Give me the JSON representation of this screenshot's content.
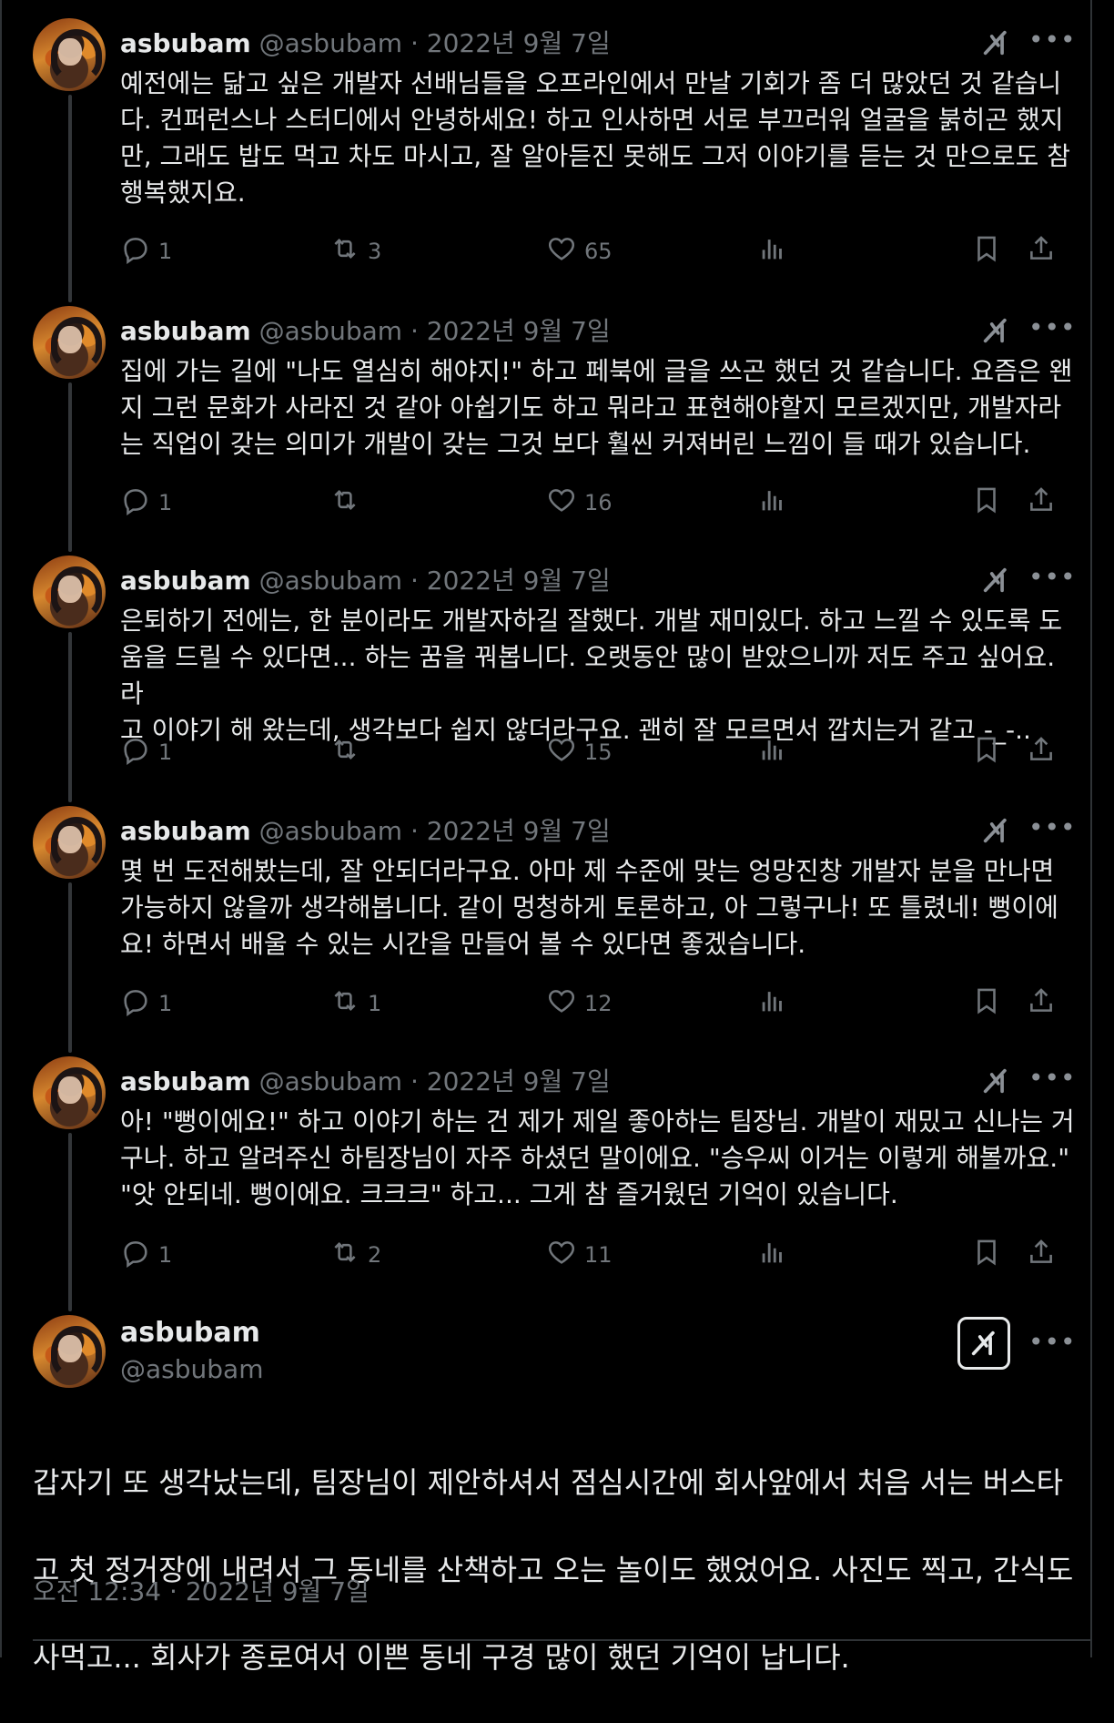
{
  "colors": {
    "background": "#000000",
    "text": "#e7e9ea",
    "muted": "#71767b",
    "divider": "#2f3336"
  },
  "replies": [
    {
      "name": "asbubam",
      "handle": "@asbubam",
      "date": "2022년 9월 7일",
      "lines": [
        "예전에는 닮고 싶은 개발자 선배님들을 오프라인에서 만날 기회가 좀 더 많았던 것 같습니",
        "다. 컨퍼런스나 스터디에서 안녕하세요! 하고 인사하면 서로 부끄러워 얼굴을 붉히곤 했지",
        "만, 그래도 밥도 먹고 차도 마시고, 잘 알아듣진 못해도 그저 이야기를 듣는 것 만으로도 참",
        "행복했지요."
      ],
      "replies": "1",
      "reposts": "3",
      "likes": "65"
    },
    {
      "name": "asbubam",
      "handle": "@asbubam",
      "date": "2022년 9월 7일",
      "lines": [
        "집에 가는 길에 \"나도 열심히 해야지!\" 하고 페북에 글을 쓰곤 했던 것 같습니다. 요즘은 왠",
        "지 그런 문화가 사라진 것 같아 아쉽기도 하고 뭐라고 표현해야할지 모르겠지만, 개발자라",
        "는 직업이 갖는 의미가 개발이 갖는 그것 보다 훨씬 커져버린 느낌이 들 때가 있습니다."
      ],
      "replies": "1",
      "reposts": "",
      "likes": "16"
    },
    {
      "name": "asbubam",
      "handle": "@asbubam",
      "date": "2022년 9월 7일",
      "lines": [
        "은퇴하기 전에는, 한 분이라도 개발자하길 잘했다. 개발 재미있다. 하고 느낄 수 있도록 도",
        "움을 드릴 수 있다면... 하는 꿈을 꿔봅니다. 오랫동안 많이 받았으니까 저도 주고 싶어요. 라",
        "고 이야기 해 왔는데, 생각보다 쉽지 않더라구요. 괜히 잘 모르면서 깝치는거 같고 -_-.."
      ],
      "replies": "1",
      "reposts": "",
      "likes": "15"
    },
    {
      "name": "asbubam",
      "handle": "@asbubam",
      "date": "2022년 9월 7일",
      "lines": [
        "몇 번 도전해봤는데, 잘 안되더라구요. 아마 제 수준에 맞는 엉망진창 개발자 분을 만나면",
        "가능하지 않을까 생각해봅니다. 같이 멍청하게 토론하고, 아 그렇구나! 또 틀렸네! 뻥이에",
        "요! 하면서 배울 수 있는 시간을 만들어 볼 수 있다면 좋겠습니다."
      ],
      "replies": "1",
      "reposts": "1",
      "likes": "12"
    },
    {
      "name": "asbubam",
      "handle": "@asbubam",
      "date": "2022년 9월 7일",
      "lines": [
        "아! \"뻥이에요!\" 하고 이야기 하는 건 제가 제일 좋아하는 팀장님. 개발이 재밌고 신나는 거",
        "구나. 하고 알려주신 하팀장님이 자주 하셨던 말이에요. \"승우씨 이거는 이렇게 해볼까요.\"",
        "\"앗 안되네. 뻥이에요. 크크크\" 하고... 그게 참 즐거웠던 기억이 있습니다."
      ],
      "replies": "1",
      "reposts": "2",
      "likes": "11"
    }
  ],
  "main": {
    "name": "asbubam",
    "handle": "@asbubam",
    "lines": [
      "갑자기 또 생각났는데, 팀장님이 제안하셔서 점심시간에 회사앞에서 처음 서는 버스타",
      "고 첫 정거장에 내려서 그 동네를 산책하고 오는 놀이도 했었어요. 사진도 찍고, 간식도",
      "사먹고... 회사가 종로여서 이쁜 동네 구경 많이 했던 기억이 납니다."
    ],
    "time": "오전 12:34 · 2022년 9월 7일"
  },
  "icons": [
    "reply-icon",
    "repost-icon",
    "like-icon",
    "views-icon",
    "bookmark-icon",
    "share-icon",
    "grok-icon",
    "more-icon"
  ]
}
